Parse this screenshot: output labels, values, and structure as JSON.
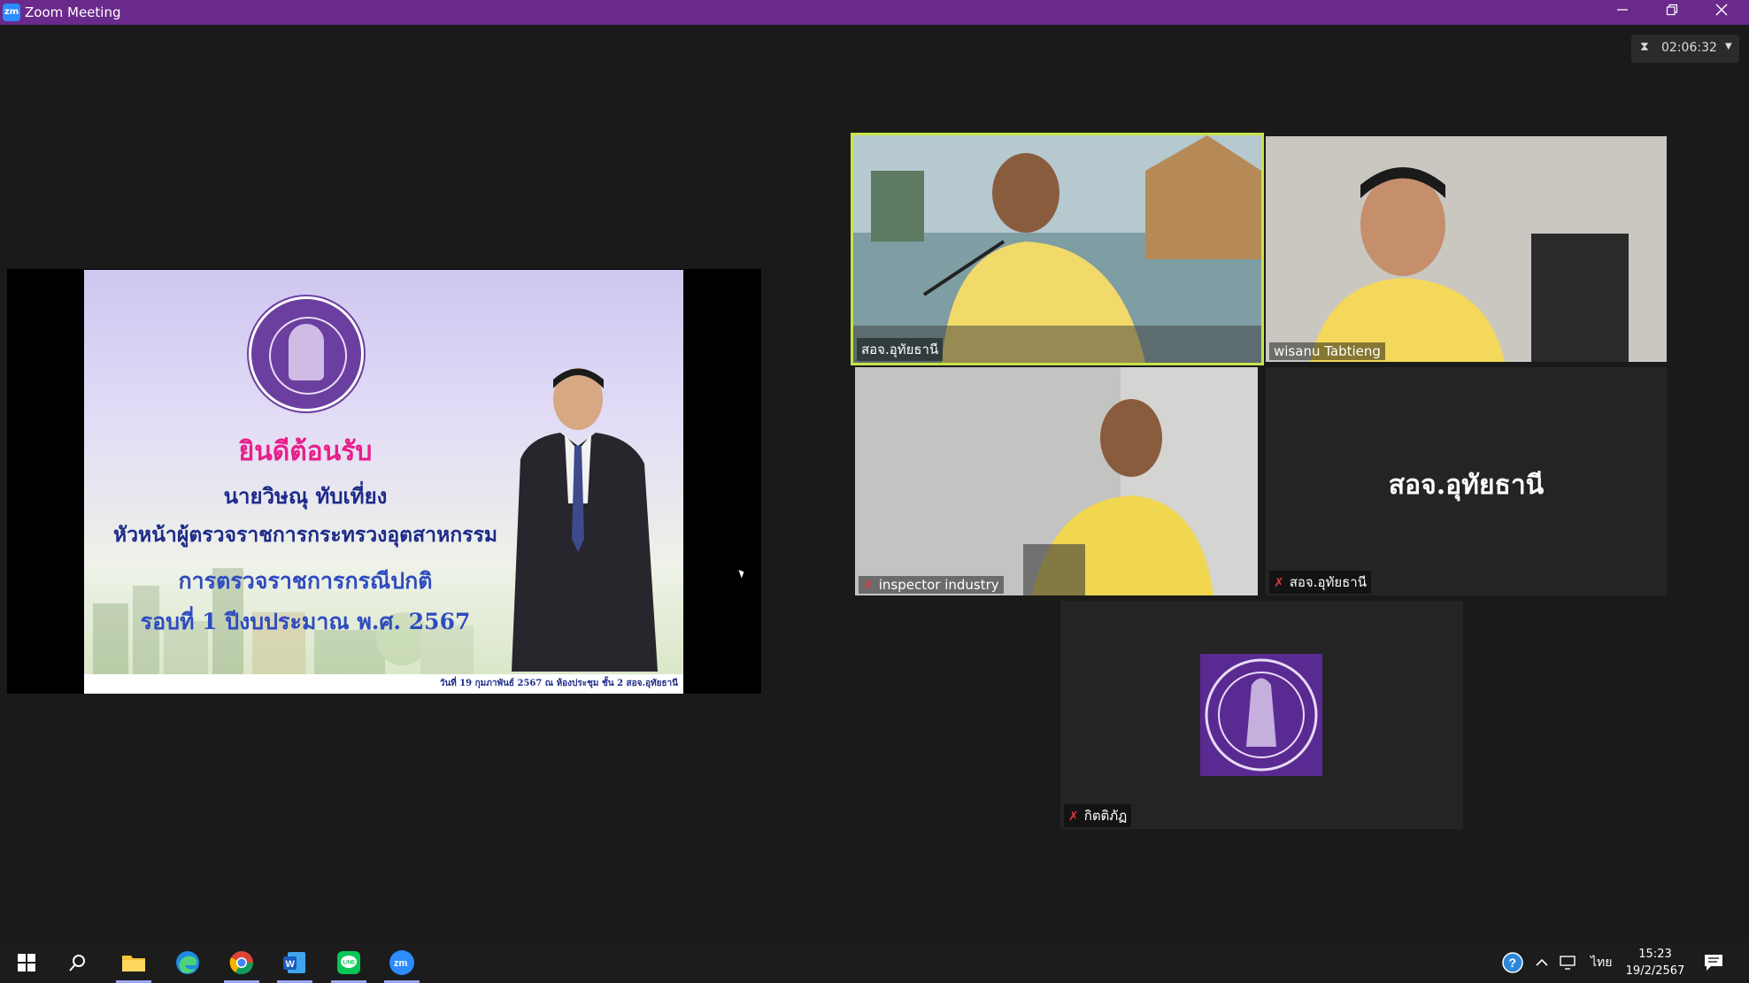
{
  "window": {
    "app_icon": "zm",
    "title": "Zoom Meeting",
    "controls": [
      "minimize-icon",
      "restore-icon",
      "close-icon"
    ]
  },
  "meeting": {
    "timer": "02:06:32"
  },
  "shared_slide": {
    "welcome": "ยินดีต้อนรับ",
    "name": "นายวิษณุ ทับเที่ยง",
    "position": "หัวหน้าผู้ตรวจราชการกระทรวงอุตสาหกรรม",
    "subject": "การตรวจราชการกรณีปกติ",
    "round": "รอบที่ 1 ปีงบประมาณ พ.ศ. 2567",
    "footer": "วันที่ 19 กุมภาพันธ์ 2567 ณ ห้องประชุม ชั้น 2 สอจ.อุทัยธานี"
  },
  "participants": [
    {
      "name": "สอจ.อุทัยธานี",
      "video": true,
      "muted": false,
      "active_speaker": true
    },
    {
      "name": "wisanu Tabtieng",
      "video": true,
      "muted": false,
      "active_speaker": false
    },
    {
      "name": "inspector industry",
      "video": true,
      "muted": true,
      "active_speaker": false
    },
    {
      "name": "สอจ.อุทัยธานี",
      "display_name": "สอจ.อุทัยธานี",
      "video": false,
      "muted": true,
      "active_speaker": false
    },
    {
      "name": "กิตติภัฏ",
      "video": false,
      "muted": true,
      "active_speaker": false
    }
  ],
  "taskbar": {
    "apps": [
      "start-icon",
      "search-icon",
      "file-explorer-icon",
      "edge-icon",
      "chrome-icon",
      "word-icon",
      "line-icon",
      "zoom-icon"
    ],
    "input_language": "ไทย",
    "time": "15:23",
    "date": "19/2/2567"
  },
  "colors": {
    "titlebar": "#6a2a8c",
    "active_speaker_border": "#c8e34a",
    "muted_icon": "#e0383e",
    "stage_bg": "#1a1a1a"
  }
}
